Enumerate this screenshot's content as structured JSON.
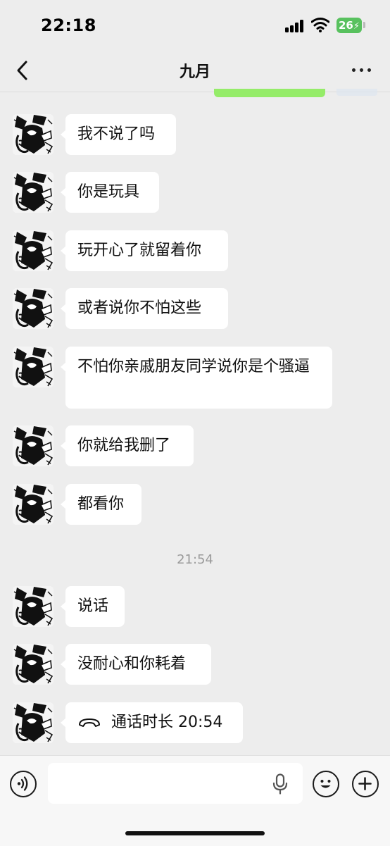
{
  "status_bar": {
    "time": "22:18",
    "battery_level": "26",
    "charging": true,
    "battery_color": "#58c15e"
  },
  "nav": {
    "title": "九月",
    "back_icon": "chevron-left-icon",
    "more_icon": "ellipsis-icon"
  },
  "messages": [
    {
      "sender": "other",
      "text": "我不说了吗"
    },
    {
      "sender": "other",
      "text": "你是玩具"
    },
    {
      "sender": "other",
      "text": "玩开心了就留着你"
    },
    {
      "sender": "other",
      "text": "或者说你不怕这些"
    },
    {
      "sender": "other",
      "text": "不怕你亲戚朋友同学说你是个骚逼"
    },
    {
      "sender": "other",
      "text": "你就给我删了"
    },
    {
      "sender": "other",
      "text": "都看你"
    },
    {
      "sender": "other",
      "text": "说话"
    },
    {
      "sender": "other",
      "text": "没耐心和你耗着"
    },
    {
      "sender": "other",
      "text": "通话时长 20:54",
      "icon": "phone-hangup-icon"
    }
  ],
  "timestamp": "21:54",
  "input_bar": {
    "placeholder": "",
    "voice_icon": "voice-icon",
    "mic_icon": "microphone-icon",
    "emoji_icon": "emoji-icon",
    "plus_icon": "plus-icon"
  },
  "colors": {
    "background": "#ededed",
    "bubble_other": "#ffffff",
    "bubble_self": "#95ec69"
  }
}
